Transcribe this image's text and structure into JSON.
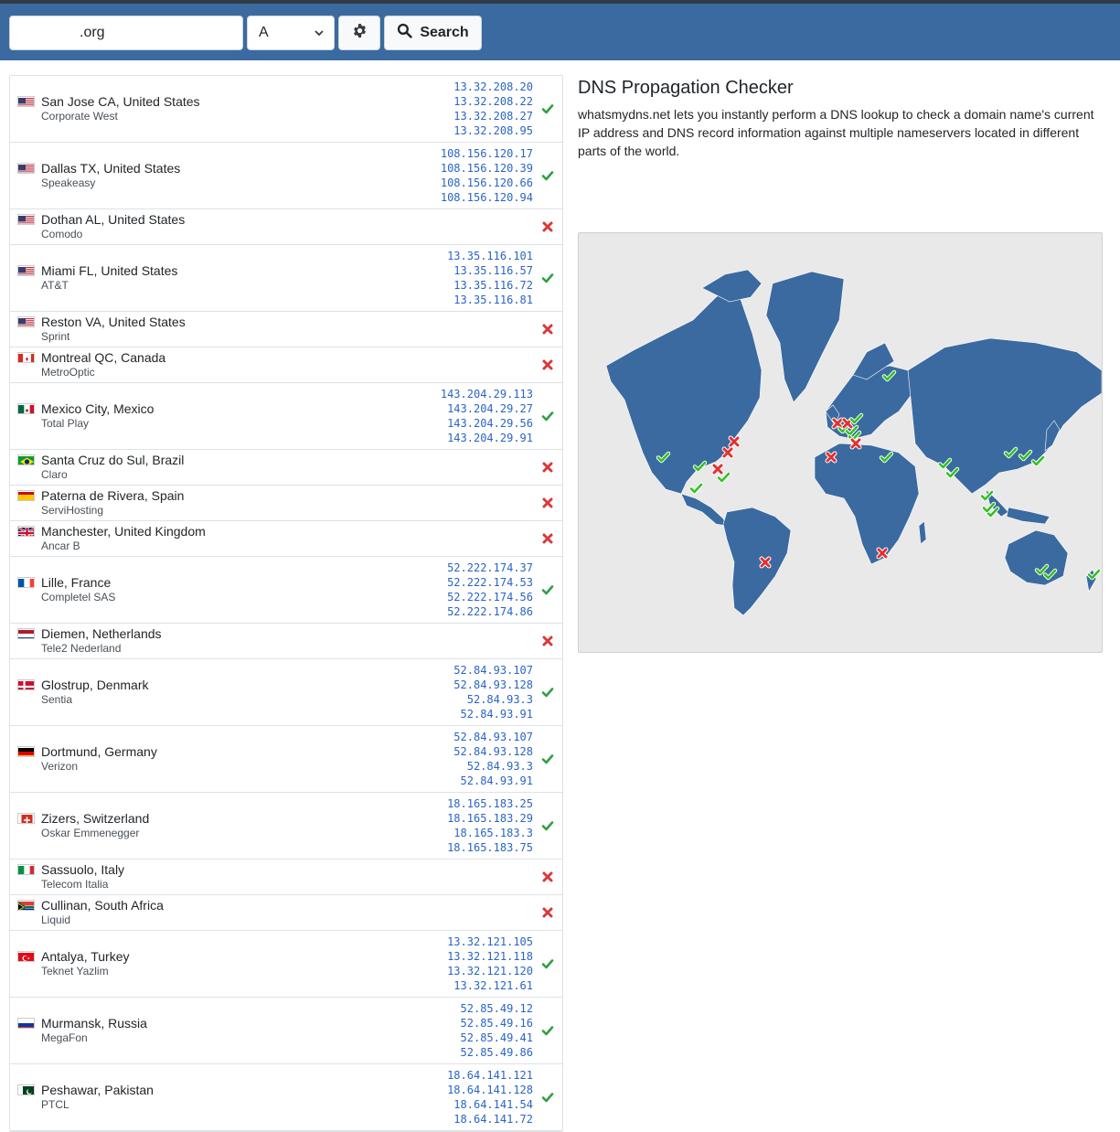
{
  "search": {
    "domain_suffix": ".org",
    "record_type": "A",
    "search_label": "Search"
  },
  "info": {
    "title": "DNS Propagation Checker",
    "description": "whatsmydns.net lets you instantly perform a DNS lookup to check a domain name's current IP address and DNS record information against multiple nameservers located in different parts of the world."
  },
  "colors": {
    "topbar": "#3a6aa0",
    "ok": "#2ea043",
    "fail": "#d73a3a",
    "land": "#3a6aa0",
    "ip_link": "#2a64c5"
  },
  "results": [
    {
      "flag": "us",
      "city": "San Jose CA, United States",
      "provider": "Corporate West",
      "status": "ok",
      "ips": [
        "13.32.208.20",
        "13.32.208.22",
        "13.32.208.27",
        "13.32.208.95"
      ]
    },
    {
      "flag": "us",
      "city": "Dallas TX, United States",
      "provider": "Speakeasy",
      "status": "ok",
      "ips": [
        "108.156.120.17",
        "108.156.120.39",
        "108.156.120.66",
        "108.156.120.94"
      ]
    },
    {
      "flag": "us",
      "city": "Dothan AL, United States",
      "provider": "Comodo",
      "status": "fail",
      "ips": []
    },
    {
      "flag": "us",
      "city": "Miami FL, United States",
      "provider": "AT&T",
      "status": "ok",
      "ips": [
        "13.35.116.101",
        "13.35.116.57",
        "13.35.116.72",
        "13.35.116.81"
      ]
    },
    {
      "flag": "us",
      "city": "Reston VA, United States",
      "provider": "Sprint",
      "status": "fail",
      "ips": []
    },
    {
      "flag": "ca",
      "city": "Montreal QC, Canada",
      "provider": "MetroOptic",
      "status": "fail",
      "ips": []
    },
    {
      "flag": "mx",
      "city": "Mexico City, Mexico",
      "provider": "Total Play",
      "status": "ok",
      "ips": [
        "143.204.29.113",
        "143.204.29.27",
        "143.204.29.56",
        "143.204.29.91"
      ]
    },
    {
      "flag": "br",
      "city": "Santa Cruz do Sul, Brazil",
      "provider": "Claro",
      "status": "fail",
      "ips": []
    },
    {
      "flag": "es",
      "city": "Paterna de Rivera, Spain",
      "provider": "ServiHosting",
      "status": "fail",
      "ips": []
    },
    {
      "flag": "gb",
      "city": "Manchester, United Kingdom",
      "provider": "Ancar B",
      "status": "fail",
      "ips": []
    },
    {
      "flag": "fr",
      "city": "Lille, France",
      "provider": "Completel SAS",
      "status": "ok",
      "ips": [
        "52.222.174.37",
        "52.222.174.53",
        "52.222.174.56",
        "52.222.174.86"
      ]
    },
    {
      "flag": "nl",
      "city": "Diemen, Netherlands",
      "provider": "Tele2 Nederland",
      "status": "fail",
      "ips": []
    },
    {
      "flag": "dk",
      "city": "Glostrup, Denmark",
      "provider": "Sentia",
      "status": "ok",
      "ips": [
        "52.84.93.107",
        "52.84.93.128",
        "52.84.93.3",
        "52.84.93.91"
      ]
    },
    {
      "flag": "de",
      "city": "Dortmund, Germany",
      "provider": "Verizon",
      "status": "ok",
      "ips": [
        "52.84.93.107",
        "52.84.93.128",
        "52.84.93.3",
        "52.84.93.91"
      ]
    },
    {
      "flag": "ch",
      "city": "Zizers, Switzerland",
      "provider": "Oskar Emmenegger",
      "status": "ok",
      "ips": [
        "18.165.183.25",
        "18.165.183.29",
        "18.165.183.3",
        "18.165.183.75"
      ]
    },
    {
      "flag": "it",
      "city": "Sassuolo, Italy",
      "provider": "Telecom Italia",
      "status": "fail",
      "ips": []
    },
    {
      "flag": "za",
      "city": "Cullinan, South Africa",
      "provider": "Liquid",
      "status": "fail",
      "ips": []
    },
    {
      "flag": "tr",
      "city": "Antalya, Turkey",
      "provider": "Teknet Yazlim",
      "status": "ok",
      "ips": [
        "13.32.121.105",
        "13.32.121.118",
        "13.32.121.120",
        "13.32.121.61"
      ]
    },
    {
      "flag": "ru",
      "city": "Murmansk, Russia",
      "provider": "MegaFon",
      "status": "ok",
      "ips": [
        "52.85.49.12",
        "52.85.49.16",
        "52.85.49.41",
        "52.85.49.86"
      ]
    },
    {
      "flag": "pk",
      "city": "Peshawar, Pakistan",
      "provider": "PTCL",
      "status": "ok",
      "ips": [
        "18.64.141.121",
        "18.64.141.128",
        "18.64.141.54",
        "18.64.141.72"
      ]
    }
  ],
  "map_markers": [
    {
      "location": "San Jose CA",
      "status": "ok"
    },
    {
      "location": "Dallas TX",
      "status": "ok"
    },
    {
      "location": "Dothan AL",
      "status": "fail"
    },
    {
      "location": "Miami FL",
      "status": "ok"
    },
    {
      "location": "Reston VA",
      "status": "fail"
    },
    {
      "location": "Montreal QC",
      "status": "fail"
    },
    {
      "location": "Mexico City",
      "status": "ok"
    },
    {
      "location": "Santa Cruz do Sul",
      "status": "fail"
    },
    {
      "location": "Paterna de Rivera",
      "status": "fail"
    },
    {
      "location": "Manchester",
      "status": "fail"
    },
    {
      "location": "Lille",
      "status": "ok"
    },
    {
      "location": "Diemen",
      "status": "fail"
    },
    {
      "location": "Glostrup",
      "status": "ok"
    },
    {
      "location": "Dortmund",
      "status": "ok"
    },
    {
      "location": "Zizers",
      "status": "ok"
    },
    {
      "location": "Sassuolo",
      "status": "fail"
    },
    {
      "location": "Cullinan",
      "status": "fail"
    },
    {
      "location": "Antalya",
      "status": "ok"
    },
    {
      "location": "Murmansk",
      "status": "ok"
    },
    {
      "location": "Peshawar",
      "status": "ok"
    },
    {
      "location": "India",
      "status": "ok"
    },
    {
      "location": "Beijing",
      "status": "ok"
    },
    {
      "location": "Seoul",
      "status": "ok"
    },
    {
      "location": "Tokyo",
      "status": "ok"
    },
    {
      "location": "Bangkok",
      "status": "ok"
    },
    {
      "location": "Singapore",
      "status": "ok"
    },
    {
      "location": "Kuala Lumpur",
      "status": "ok"
    },
    {
      "location": "Melbourne",
      "status": "ok"
    },
    {
      "location": "Canberra",
      "status": "ok"
    },
    {
      "location": "Auckland",
      "status": "ok"
    }
  ]
}
